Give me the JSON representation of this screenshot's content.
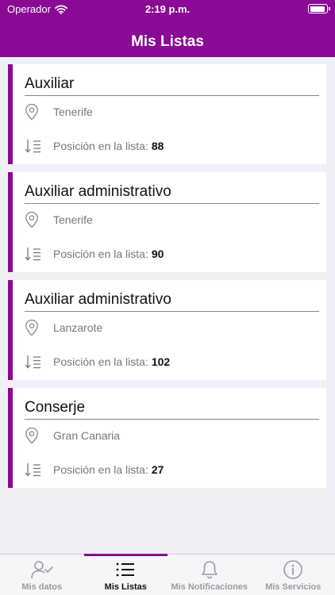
{
  "status": {
    "carrier": "Operador",
    "time": "2:19 p.m."
  },
  "header": {
    "title": "Mis Listas"
  },
  "position_label": "Posición en la lista:",
  "cards": [
    {
      "title": "Auxiliar",
      "location": "Tenerife",
      "position": "88"
    },
    {
      "title": "Auxiliar administrativo",
      "location": "Tenerife",
      "position": "90"
    },
    {
      "title": "Auxiliar administrativo",
      "location": "Lanzarote",
      "position": "102"
    },
    {
      "title": "Conserje",
      "location": "Gran Canaria",
      "position": "27"
    }
  ],
  "tabs": [
    {
      "label": "Mis datos",
      "icon": "user-check-icon",
      "active": false
    },
    {
      "label": "Mis Listas",
      "icon": "list-icon",
      "active": true
    },
    {
      "label": "Mis Notificaciones",
      "icon": "bell-icon",
      "active": false
    },
    {
      "label": "Mis Servicios",
      "icon": "info-icon",
      "active": false
    }
  ],
  "colors": {
    "brand": "#8a0a96",
    "background": "#eef0f5"
  }
}
